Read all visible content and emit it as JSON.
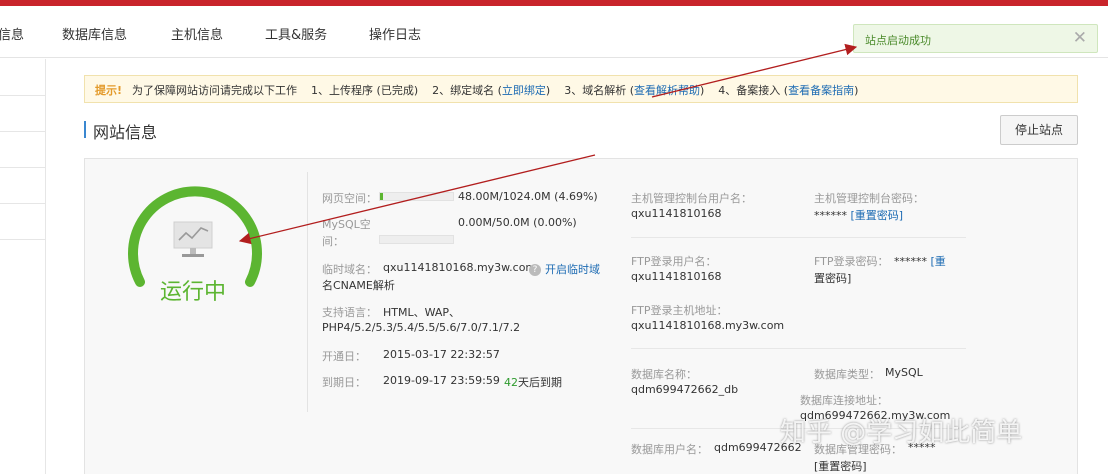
{
  "nav": {
    "items": [
      "信息",
      "数据库信息",
      "主机信息",
      "工具&服务",
      "操作日志"
    ]
  },
  "toast": {
    "message": "站点启动成功",
    "close": "✕"
  },
  "notice": {
    "tip": "提示!",
    "intro": "为了保障网站访问请完成以下工作",
    "step1": "1、上传程序 (已完成)",
    "step2_pre": "2、绑定域名 (",
    "step2_link": "立即绑定",
    "step3_pre": "3、域名解析 (",
    "step3_link": "查看解析帮助",
    "step4_pre": "4、备案接入 (",
    "step4_link": "查看备案指南",
    "close_paren": ")"
  },
  "section": {
    "title": "网站信息",
    "stop_button": "停止站点"
  },
  "status": {
    "label": "运行中"
  },
  "info": {
    "web_space_label": "网页空间：",
    "web_space_value": "48.00M/1024.0M (4.69%)",
    "web_space_used_fraction": 0.0469,
    "mysql_label_1": "MySQL空",
    "mysql_label_2": "间：",
    "mysql_value": "0.00M/50.0M (0.00%)",
    "mysql_used_fraction": 0.0,
    "temp_domain_label": "临时域名：",
    "temp_domain_value": "qxu1141810168.my3w.com",
    "temp_domain_link_1": "开启临时域",
    "temp_domain_link_2": "名CNAME解析",
    "lang_label": "支持语言：",
    "lang_value_1": "HTML、WAP、",
    "lang_value_2": "PHP4/5.2/5.3/5.4/5.5/5.6/7.0/7.1/7.2",
    "open_date_label": "开通日：",
    "open_date_value": "2015-03-17 22:32:57",
    "expire_label": "到期日：",
    "expire_value": "2019-09-17 23:59:59",
    "expire_days": "42",
    "expire_suffix": "天后到期"
  },
  "right": {
    "host_user_label": "主机管理控制台用户名：",
    "host_user_value": "qxu1141810168",
    "host_pwd_label": "主机管理控制台密码：",
    "host_pwd_value": "******",
    "reset_pwd": "[重置密码]",
    "ftp_user_label": "FTP登录用户名：",
    "ftp_user_value": "qxu1141810168",
    "ftp_pwd_label": "FTP登录密码：",
    "ftp_pwd_value": "******",
    "reset_pwd_part1": "[重",
    "reset_pwd_part2": "置密码]",
    "ftp_host_label": "FTP登录主机地址：",
    "ftp_host_value": "qxu1141810168.my3w.com",
    "db_name_label": "数据库名称：",
    "db_name_value": "qdm699472662_db",
    "db_type_label": "数据库类型：",
    "db_type_value": "MySQL",
    "db_conn_label": "数据库连接地址：",
    "db_conn_value": "qdm699472662.my3w.com",
    "db_user_label": "数据库用户名：",
    "db_user_value": "qdm699472662",
    "db_pwd_label": "数据库管理密码：",
    "db_pwd_value": "*****",
    "db_reset": "[重置密码]"
  },
  "watermark": "知乎 @学习如此简单",
  "colors": {
    "accent_red": "#c9242b",
    "status_green": "#5cb531",
    "link_blue": "#1d6bb3",
    "arrow_red": "#b21e1e"
  }
}
